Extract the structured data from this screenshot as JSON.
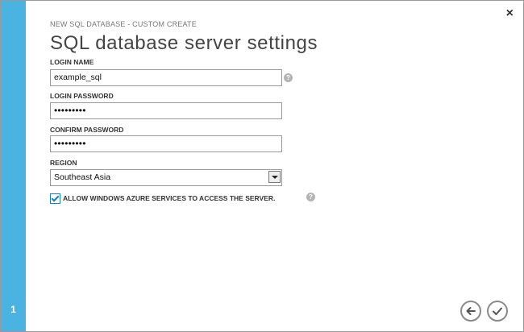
{
  "wizard": {
    "breadcrumb": "NEW SQL DATABASE - CUSTOM CREATE",
    "title": "SQL database server settings",
    "step": "1",
    "close_symbol": "×"
  },
  "form": {
    "login_name": {
      "label": "LOGIN NAME",
      "value": "example_sql"
    },
    "login_password": {
      "label": "LOGIN PASSWORD",
      "value": "•••••••••"
    },
    "confirm_password": {
      "label": "CONFIRM PASSWORD",
      "value": "•••••••••"
    },
    "region": {
      "label": "REGION",
      "value": "Southeast Asia"
    },
    "allow_azure": {
      "label": "ALLOW WINDOWS AZURE SERVICES TO ACCESS THE SERVER.",
      "checked": true
    },
    "help_symbol": "?"
  },
  "icons": {
    "close": "close-icon",
    "help": "help-icon",
    "back": "back-arrow-icon",
    "complete": "checkmark-icon",
    "dropdown": "chevron-down-icon"
  },
  "colors": {
    "sidebar": "#4ab3e2",
    "checkbox": "#1e7bc8",
    "help": "#b4b4b4"
  }
}
